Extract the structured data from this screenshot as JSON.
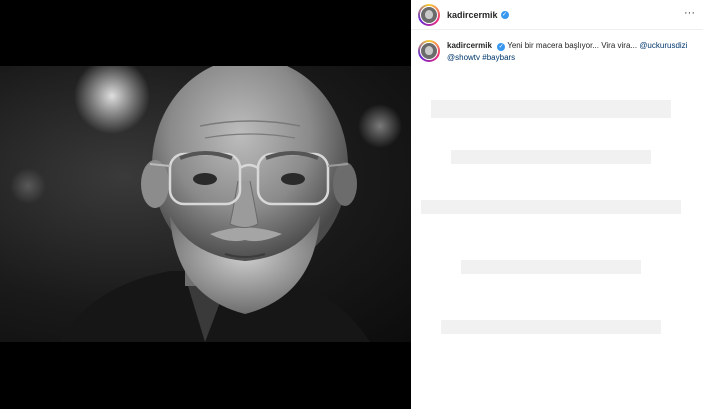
{
  "post": {
    "username": "kadircermik",
    "verified_icon": "verified-badge-icon",
    "more_icon": "ellipsis-icon",
    "more_glyph": "···",
    "caption": {
      "username": "kadircermik",
      "text": "Yeni bir macera başlıyor... Vira vira...",
      "mention_1": "@uckurusdizi",
      "mention_2": "@showtv",
      "hashtag": "#baybars"
    }
  },
  "colors": {
    "media_background": "#000000",
    "panel_background": "#ffffff",
    "verified": "#3897f0",
    "link": "#00376b",
    "text": "#262626"
  }
}
